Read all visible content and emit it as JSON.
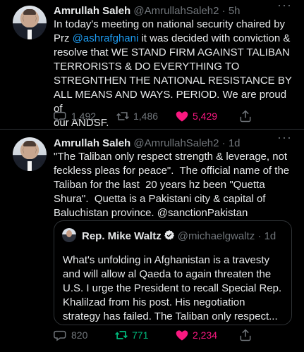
{
  "tweets": [
    {
      "author": "Amrullah Saleh",
      "handle": "@AmrullahSaleh2",
      "dot": "·",
      "time": "5h",
      "more": "···",
      "text_before_link": "In today's meeting on national security chaired by\nPrz ",
      "link": "@ashrafghani",
      "text_after_link": " it was decided with conviction &\nresolve that WE STAND FIRM AGAINST TALIBAN\nTERRORISTS & DO EVERYTHING TO\nSTREGNTHEN THE NATIONAL RESISTANCE BY\nALL MEANS AND WAYS. PERIOD. We are proud of\nour ANDSF.",
      "replies": "1,492",
      "retweets": "1,486",
      "likes": "5,429"
    },
    {
      "author": "Amrullah Saleh",
      "handle": "@AmrullahSaleh2",
      "dot": "·",
      "time": "1d",
      "more": "···",
      "text": "\"The Taliban only respect strength & leverage, not\nfeckless pleas for peace\".  The official name of the\nTaliban for the last  20 years hz been \"Quetta\nShura\".  Quetta is a Pakistani city & capital of\nBaluchistan province. @sanctionPakistan",
      "quote": {
        "author": "Rep. Mike Waltz",
        "handle": "@michaelgwaltz",
        "dot": "·",
        "time": "1d",
        "text": "What's unfolding in Afghanistan is a travesty\nand will allow al Qaeda to again threaten the\nU.S. I urge the President to recall Special Rep.\nKhalilzad from his post. His negotiation\nstrategy has failed. The Taliban only respect..."
      },
      "replies": "820",
      "retweets": "771",
      "likes": "2,234"
    }
  ],
  "colors": {
    "background": "#000000",
    "text": "#e7e9ea",
    "muted": "#71767b",
    "link": "#1d9bf0",
    "like": "#f91880",
    "retweet": "#00ba7c"
  },
  "icons": {
    "reply": "reply-icon",
    "retweet": "retweet-icon",
    "like": "heart-icon",
    "share": "share-icon",
    "verified": "verified-icon"
  }
}
